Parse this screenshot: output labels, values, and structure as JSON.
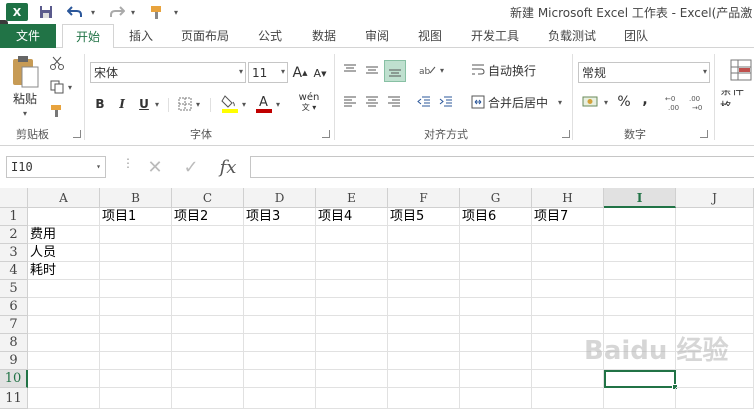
{
  "window": {
    "title": "新建 Microsoft Excel 工作表 - Excel(产品激",
    "logo_text": "X"
  },
  "quick_access": {
    "save_icon": "save-icon",
    "undo_icon": "undo-icon",
    "redo_icon": "redo-icon",
    "customize_icon": "customize-icon"
  },
  "tabs": [
    "文件",
    "开始",
    "插入",
    "页面布局",
    "公式",
    "数据",
    "审阅",
    "视图",
    "开发工具",
    "负载测试",
    "团队"
  ],
  "ribbon": {
    "clipboard": {
      "paste_label": "粘贴",
      "group_label": "剪贴板"
    },
    "font": {
      "font_name": "宋体",
      "font_size": "11",
      "group_label": "字体",
      "bold": "B",
      "italic": "I",
      "underline": "U",
      "grow": "A",
      "shrink": "A",
      "phonetic": "wén"
    },
    "alignment": {
      "wrap_text": "自动换行",
      "merge_center": "合并后居中",
      "group_label": "对齐方式"
    },
    "number": {
      "format": "常规",
      "group_label": "数字",
      "percent": "%",
      "comma": ","
    },
    "styles": {
      "conditional_label": "条件格"
    }
  },
  "formula_bar": {
    "name_box": "I10",
    "fx": "fx",
    "formula": ""
  },
  "sheet": {
    "columns": [
      "A",
      "B",
      "C",
      "D",
      "E",
      "F",
      "G",
      "H",
      "I",
      "J"
    ],
    "selected_column": "I",
    "rows": [
      "1",
      "2",
      "3",
      "4",
      "5",
      "6",
      "7",
      "8",
      "9",
      "10",
      "11"
    ],
    "selected_row": "10",
    "active_cell": "I10",
    "cells": {
      "B1": "项目1",
      "C1": "项目2",
      "D1": "项目3",
      "E1": "项目4",
      "F1": "项目5",
      "G1": "项目6",
      "H1": "项目7",
      "A2": "费用",
      "A3": "人员",
      "A4": "耗时"
    }
  },
  "watermark": "Baidu 经验",
  "colors": {
    "accent": "#217346",
    "highlight_yellow": "#ffff00",
    "font_red": "#c00000"
  }
}
